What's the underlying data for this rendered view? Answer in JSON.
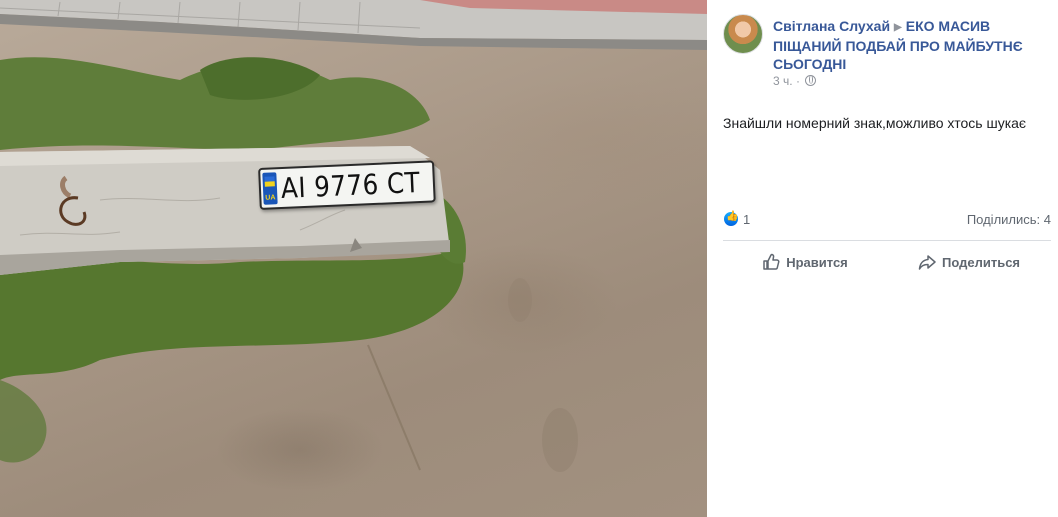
{
  "photo": {
    "plate_region": "UA",
    "plate_number": "AI 9776 CT"
  },
  "post": {
    "author_name": "Світлана Слухай",
    "group_name": "ЕКО МАСИВ ПІЩАНИЙ ПОДБАЙ ПРО МАЙБУТНЄ СЬОГОДНІ",
    "timestamp": "3 ч.",
    "privacy_icon": "globe-icon",
    "text": "Знайшли номерний знак,можливо хтось шукає",
    "reaction_icon": "like-reaction-icon",
    "like_count": "1",
    "shares_label": "Поділились: 4",
    "like_button_label": "Нравится",
    "share_button_label": "Поделиться"
  },
  "colors": {
    "link_blue": "#385898",
    "secondary_text": "#606770",
    "meta_text": "#90949c",
    "divider": "#dadde1"
  }
}
